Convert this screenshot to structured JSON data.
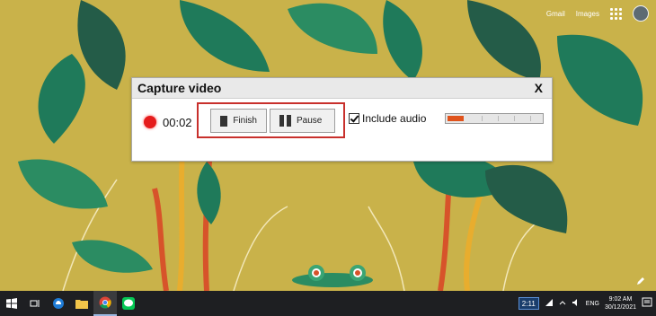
{
  "header": {
    "gmail": "Gmail",
    "images": "Images"
  },
  "dialog": {
    "title": "Capture video",
    "close": "X",
    "timer": "00:02",
    "finish_label": "Finish",
    "pause_label": "Pause",
    "include_audio_label": "Include audio",
    "include_audio_checked": true,
    "audio_level": 0.17
  },
  "taskbar": {
    "battery": "2:11",
    "language": "ENG",
    "time": "9:02 AM",
    "date": "30/12/2021",
    "icons": [
      "windows-start-icon",
      "task-view-icon",
      "edge-icon",
      "file-explorer-icon",
      "chrome-icon",
      "line-icon"
    ]
  },
  "colors": {
    "record": "#e51c1c",
    "highlight": "#c8302c",
    "meter_fill": "#e0531c"
  }
}
